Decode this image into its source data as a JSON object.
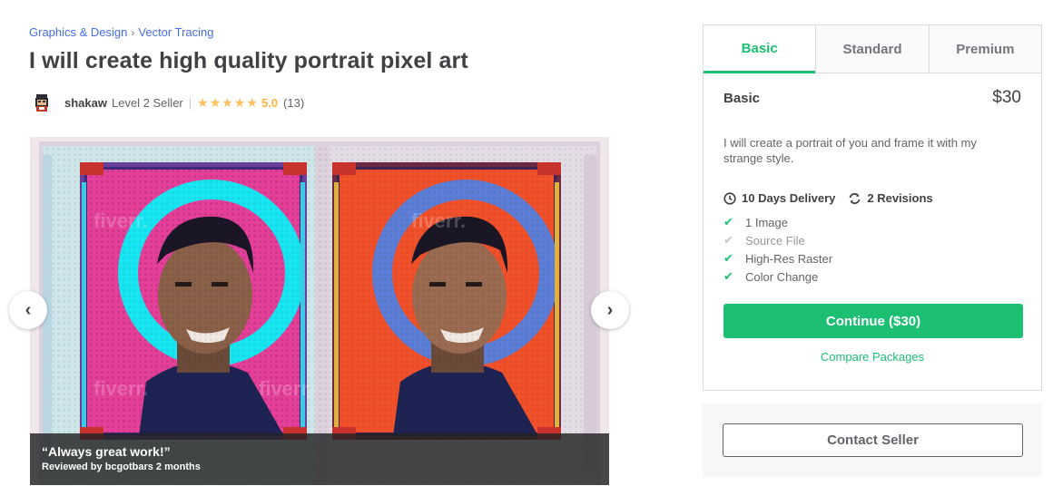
{
  "breadcrumb": {
    "category": "Graphics & Design",
    "separator": "›",
    "subcategory": "Vector Tracing"
  },
  "gig": {
    "title": "I will create high quality portrait pixel art"
  },
  "seller": {
    "name": "shakaw",
    "level": "Level 2 Seller",
    "divider": "|",
    "stars": 5,
    "rating": "5.0",
    "review_count": "(13)"
  },
  "gallery": {
    "watermark": "fiverr.",
    "review_quote": "“Always great work!”",
    "review_by": "Reviewed by bcgotbars 2 months",
    "prev_icon": "chevron-left-icon",
    "next_icon": "chevron-right-icon",
    "prev_glyph": "‹",
    "next_glyph": "›"
  },
  "package": {
    "tabs": [
      {
        "label": "Basic",
        "active": true
      },
      {
        "label": "Standard",
        "active": false
      },
      {
        "label": "Premium",
        "active": false
      }
    ],
    "name": "Basic",
    "price": "$30",
    "description": "I will create a portrait of you and frame it with my strange style.",
    "delivery": "10 Days Delivery",
    "revisions": "2 Revisions",
    "features": [
      {
        "label": "1 Image",
        "included": true
      },
      {
        "label": "Source File",
        "included": false
      },
      {
        "label": "High-Res Raster",
        "included": true
      },
      {
        "label": "Color Change",
        "included": true
      }
    ],
    "continue_label": "Continue ($30)",
    "compare_label": "Compare Packages"
  },
  "contact": {
    "label": "Contact Seller"
  },
  "colors": {
    "accent": "#1dbf73",
    "link": "#446ee7",
    "star": "#ffbe5b"
  }
}
